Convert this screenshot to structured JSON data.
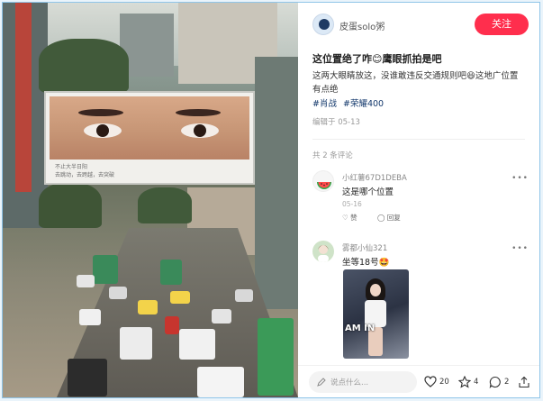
{
  "post": {
    "author": "皮蛋solo粥",
    "follow_label": "关注",
    "title": "这位置绝了咋😊鹰眼抓拍是吧",
    "desc_line1": "这两大眼睛放这，没谁敢违反交通规则吧😆这地广位置",
    "desc_line2": "有点绝",
    "tags": [
      "#肖战",
      "#荣耀400"
    ],
    "edited": "编辑于 05-13",
    "comment_count": "共 2 条评论"
  },
  "billboard": {
    "caption_line1": "不止大半日阳",
    "caption_line2": "去跳动，去跨越，去突破"
  },
  "comments": [
    {
      "author": "小红薯67D1DEBA",
      "text": "这是哪个位置",
      "date": "05-16",
      "like_label": "赞",
      "reply_label": "回复"
    },
    {
      "author": "雾都小仙321",
      "text": "坐等18号🤩",
      "photo_text": "AM IN"
    }
  ],
  "footer": {
    "placeholder": "说点什么...",
    "likes": "20",
    "collects": "4",
    "comments": "2"
  },
  "colors": {
    "follow_bg": "#ff2e4d",
    "tag": "#13386c"
  },
  "icons": [
    "pen-icon",
    "heart-icon",
    "star-icon",
    "chat-icon",
    "share-icon",
    "more-icon"
  ]
}
